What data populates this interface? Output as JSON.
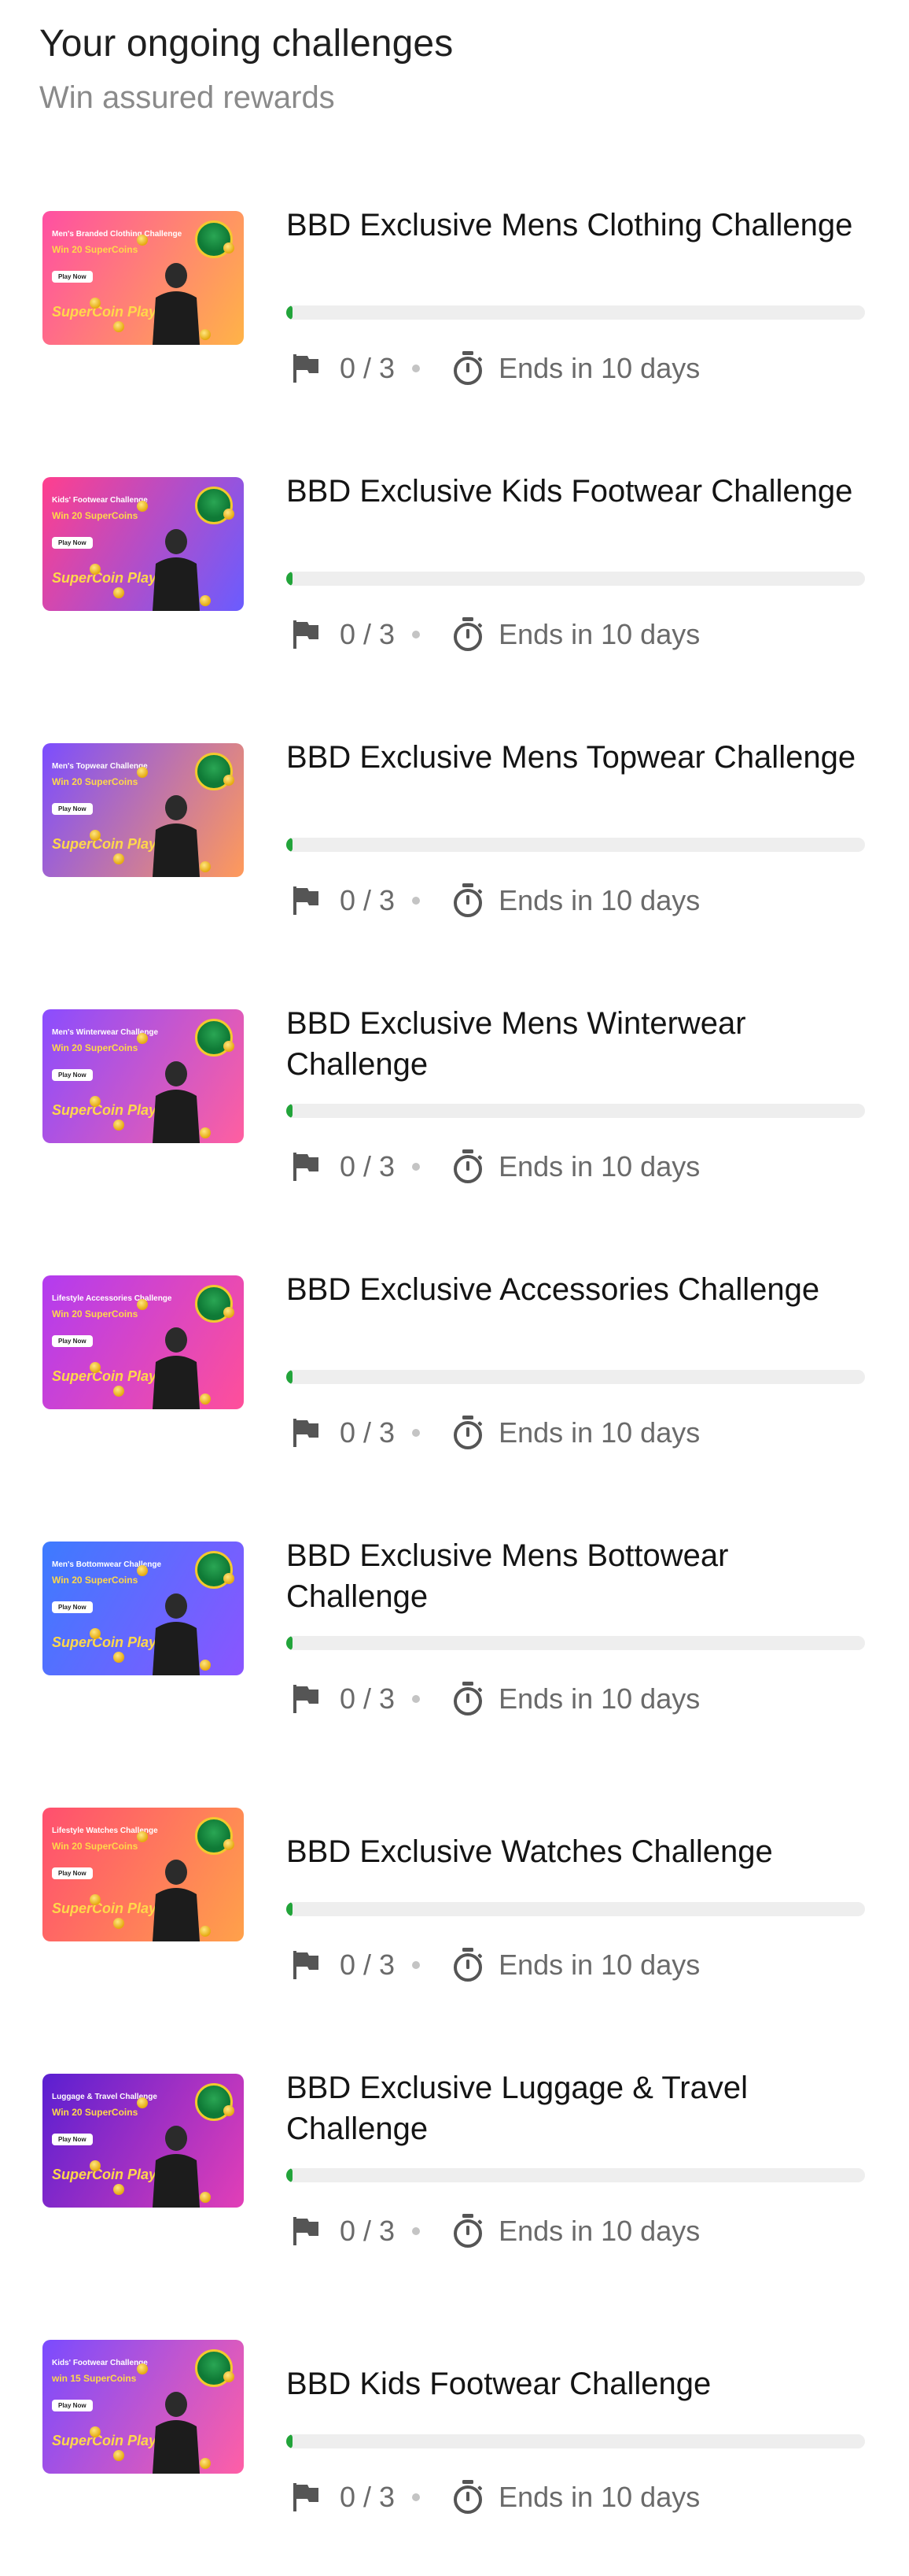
{
  "header": {
    "title": "Your ongoing challenges",
    "subtitle": "Win assured rewards"
  },
  "challenges": [
    {
      "title": "BBD Exclusive Mens Clothing Challenge",
      "thumb_line1": "Men's Branded Clothing Challenge",
      "thumb_line2": "Win 20 SuperCoins",
      "thumb_button": "Play Now",
      "thumb_brand": "SuperCoin Play",
      "thumb_colors": [
        "#ff4fa3",
        "#ffb347"
      ],
      "progress_text": "0 / 3",
      "progress_fraction": 0,
      "deadline_text": "Ends in 10 days"
    },
    {
      "title": "BBD Exclusive Kids Footwear Challenge",
      "thumb_line1": "Kids' Footwear Challenge",
      "thumb_line2": "Win 20 SuperCoins",
      "thumb_button": "Play Now",
      "thumb_brand": "SuperCoin Play",
      "thumb_colors": [
        "#ff3f8e",
        "#6a5cff"
      ],
      "progress_text": "0 / 3",
      "progress_fraction": 0,
      "deadline_text": "Ends in 10 days"
    },
    {
      "title": "BBD Exclusive Mens Topwear Challenge",
      "thumb_line1": "Men's Topwear Challenge",
      "thumb_line2": "Win 20 SuperCoins",
      "thumb_button": "Play Now",
      "thumb_brand": "SuperCoin Play",
      "thumb_colors": [
        "#7b4dff",
        "#ff9a5a"
      ],
      "progress_text": "0 / 3",
      "progress_fraction": 0,
      "deadline_text": "Ends in 10 days"
    },
    {
      "title": "BBD Exclusive Mens Winterwear Challenge",
      "thumb_line1": "Men's Winterwear Challenge",
      "thumb_line2": "Win 20 SuperCoins",
      "thumb_button": "Play Now",
      "thumb_brand": "SuperCoin Play",
      "thumb_colors": [
        "#8a4dff",
        "#ff5fa0"
      ],
      "progress_text": "0 / 3",
      "progress_fraction": 0,
      "deadline_text": "Ends in 10 days"
    },
    {
      "title": "BBD Exclusive Accessories Challenge",
      "thumb_line1": "Lifestyle Accessories Challenge",
      "thumb_line2": "Win 20 SuperCoins",
      "thumb_button": "Play Now",
      "thumb_brand": "SuperCoin Play",
      "thumb_colors": [
        "#b23cf0",
        "#ff4f9a"
      ],
      "progress_text": "0 / 3",
      "progress_fraction": 0,
      "deadline_text": "Ends in 10 days"
    },
    {
      "title": "BBD Exclusive Mens Bottowear Challenge",
      "thumb_line1": "Men's Bottomwear Challenge",
      "thumb_line2": "Win 20 SuperCoins",
      "thumb_button": "Play Now",
      "thumb_brand": "SuperCoin Play",
      "thumb_colors": [
        "#3d7bff",
        "#8a55ff"
      ],
      "progress_text": "0 / 3",
      "progress_fraction": 0,
      "deadline_text": "Ends in 10 days"
    },
    {
      "title": "BBD Exclusive Watches Challenge",
      "thumb_line1": "Lifestyle Watches Challenge",
      "thumb_line2": "Win 20 SuperCoins",
      "thumb_button": "Play Now",
      "thumb_brand": "SuperCoin Play",
      "thumb_colors": [
        "#ff4f6f",
        "#ffa14a"
      ],
      "progress_text": "0 / 3",
      "progress_fraction": 0,
      "deadline_text": "Ends in 10 days"
    },
    {
      "title": "BBD Exclusive Luggage & Travel Challenge",
      "thumb_line1": "Luggage & Travel Challenge",
      "thumb_line2": "Win 20 SuperCoins",
      "thumb_button": "Play Now",
      "thumb_brand": "SuperCoin Play",
      "thumb_colors": [
        "#5a1fd1",
        "#e23fb7"
      ],
      "progress_text": "0 / 3",
      "progress_fraction": 0,
      "deadline_text": "Ends in 10 days"
    },
    {
      "title": "BBD Kids Footwear Challenge",
      "thumb_line1": "Kids' Footwear Challenge",
      "thumb_line2": "win 15 SuperCoins",
      "thumb_button": "Play Now",
      "thumb_brand": "SuperCoin Play",
      "thumb_colors": [
        "#7a4bff",
        "#ff5fa6"
      ],
      "progress_text": "0 / 3",
      "progress_fraction": 0,
      "deadline_text": "Ends in 10 days"
    }
  ],
  "theme": {
    "progress_fill": "#22a43a",
    "progress_track": "#eeeeee",
    "icon_color": "#555555"
  },
  "icons": {
    "flag": "flag-icon",
    "timer": "stopwatch-icon"
  }
}
